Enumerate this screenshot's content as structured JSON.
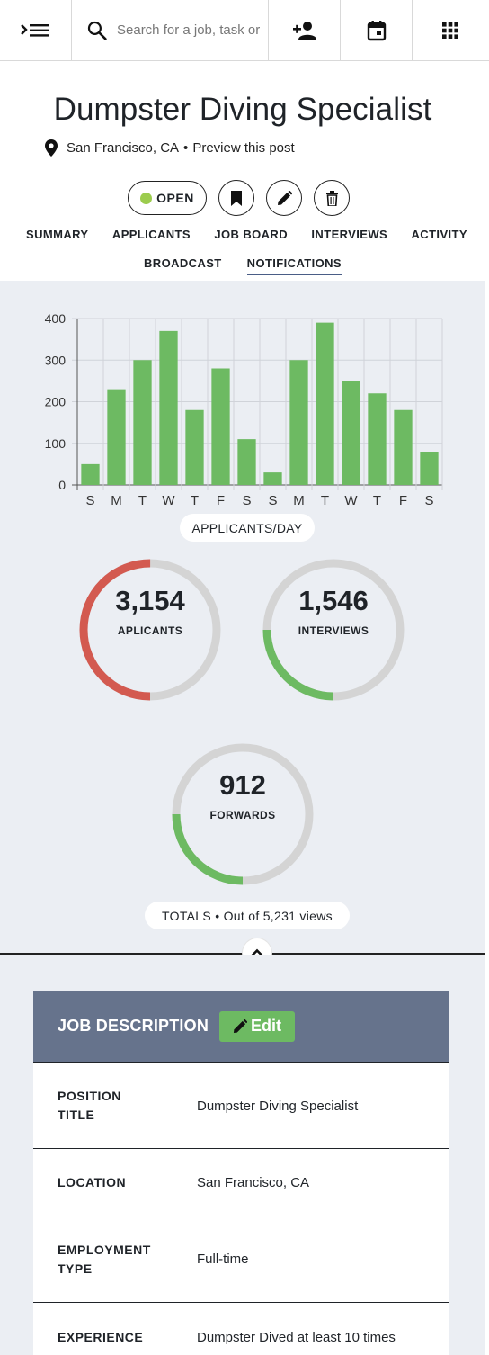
{
  "topbar": {
    "search_placeholder": "Search for a job, task or",
    "icons": [
      "menu-expand-icon",
      "search-icon",
      "add-user-icon",
      "calendar-icon",
      "apps-grid-icon"
    ]
  },
  "job": {
    "title": "Dumpster Diving Specialist",
    "location": "San Francisco, CA",
    "separator": "•",
    "preview_link": "Preview this post",
    "status": "OPEN",
    "status_color": "#9ccc4e"
  },
  "tabs_row1": [
    "SUMMARY",
    "APPLICANTS",
    "JOB BOARD",
    "INTERVIEWS",
    "ACTIVITY"
  ],
  "tabs_row2": [
    "BROADCAST",
    "NOTIFICATIONS"
  ],
  "active_tab": "NOTIFICATIONS",
  "chart_data": {
    "type": "bar",
    "categories": [
      "S",
      "M",
      "T",
      "W",
      "T",
      "F",
      "S",
      "S",
      "M",
      "T",
      "W",
      "T",
      "F",
      "S"
    ],
    "values": [
      50,
      230,
      300,
      370,
      180,
      280,
      110,
      30,
      300,
      390,
      250,
      220,
      180,
      80
    ],
    "yticks": [
      "0",
      "100",
      "200",
      "300",
      "400"
    ],
    "ylim": [
      0,
      400
    ],
    "grid": true,
    "bar_color": "#6dba62",
    "xlabel": "APPLICANTS/DAY"
  },
  "totals": {
    "applicants": {
      "value": "3,154",
      "label": "APLICANTS",
      "fraction": 0.5,
      "color": "#d35a50"
    },
    "interviews": {
      "value": "1,546",
      "label": "INTERVIEWS",
      "fraction": 0.25,
      "color": "#6dba62"
    },
    "forwards": {
      "value": "912",
      "label": "FORWARDS",
      "fraction": 0.25,
      "color": "#6dba62"
    },
    "caption": "TOTALS • Out of 5,231 views"
  },
  "job_description": {
    "heading": "JOB DESCRIPTION",
    "edit_label": "Edit",
    "rows": [
      {
        "label_line1": "POSITION",
        "label_line2": "TITLE",
        "value": "Dumpster Diving Specialist"
      },
      {
        "label_line1": "LOCATION",
        "label_line2": "",
        "value": "San Francisco, CA"
      },
      {
        "label_line1": "EMPLOYMENT",
        "label_line2": "TYPE",
        "value": "Full-time"
      },
      {
        "label_line1": "EXPERIENCE",
        "label_line2": "",
        "value": "Dumpster Dived at least 10 times"
      }
    ]
  }
}
